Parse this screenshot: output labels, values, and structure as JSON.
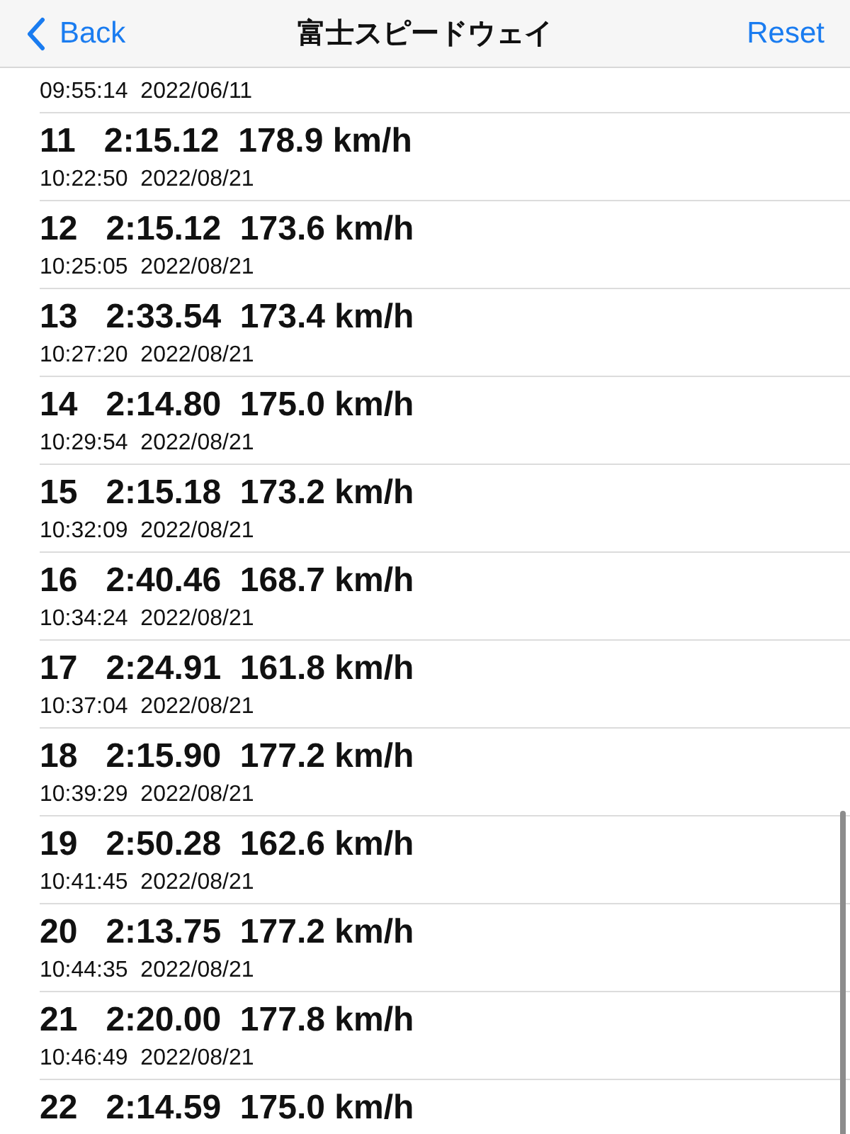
{
  "nav": {
    "back": "Back",
    "title": "富士スピードウェイ",
    "action": "Reset"
  },
  "laps": [
    {
      "subtitle": "09:55:14  2022/06/11"
    },
    {
      "title": "11   2:15.12  178.9 km/h",
      "subtitle": "10:22:50  2022/08/21"
    },
    {
      "title": "12   2:15.12  173.6 km/h",
      "subtitle": "10:25:05  2022/08/21"
    },
    {
      "title": "13   2:33.54  173.4 km/h",
      "subtitle": "10:27:20  2022/08/21"
    },
    {
      "title": "14   2:14.80  175.0 km/h",
      "subtitle": "10:29:54  2022/08/21"
    },
    {
      "title": "15   2:15.18  173.2 km/h",
      "subtitle": "10:32:09  2022/08/21"
    },
    {
      "title": "16   2:40.46  168.7 km/h",
      "subtitle": "10:34:24  2022/08/21"
    },
    {
      "title": "17   2:24.91  161.8 km/h",
      "subtitle": "10:37:04  2022/08/21"
    },
    {
      "title": "18   2:15.90  177.2 km/h",
      "subtitle": "10:39:29  2022/08/21"
    },
    {
      "title": "19   2:50.28  162.6 km/h",
      "subtitle": "10:41:45  2022/08/21"
    },
    {
      "title": "20   2:13.75  177.2 km/h",
      "subtitle": "10:44:35  2022/08/21"
    },
    {
      "title": "21   2:20.00  177.8 km/h",
      "subtitle": "10:46:49  2022/08/21"
    },
    {
      "title": "22   2:14.59  175.0 km/h"
    }
  ]
}
